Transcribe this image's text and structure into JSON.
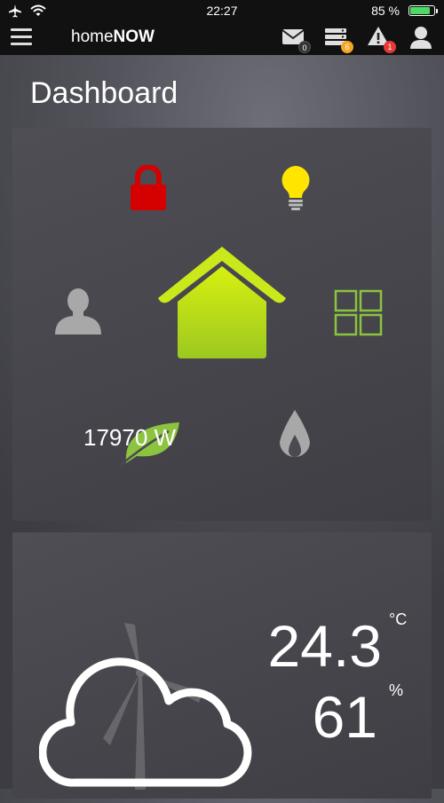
{
  "status_bar": {
    "time": "22:27",
    "battery_percent_label": "85 %",
    "battery_level": 0.85,
    "colors": {
      "battery_fill": "#4cd964"
    }
  },
  "header": {
    "brand_light": "home",
    "brand_bold": "NOW",
    "messages_count": "0",
    "server_count": "6",
    "alerts_count": "1",
    "icons": [
      "menu-icon",
      "mail-icon",
      "server-icon",
      "warning-icon",
      "user-icon"
    ],
    "colors": {
      "server_badge": "#f5a623",
      "alert_badge": "#e53935"
    }
  },
  "page": {
    "title": "Dashboard"
  },
  "home_panel": {
    "power_reading": "17970 W",
    "icons": [
      "lock-icon",
      "lightbulb-icon",
      "person-icon",
      "house-icon",
      "grid-icon",
      "leaf-icon",
      "flame-icon"
    ],
    "colors": {
      "lock": "#d50000",
      "light": "#ffe600",
      "house": "#c6e31a",
      "leaf": "#8cc33f",
      "neutral": "#a8a8a8"
    }
  },
  "weather_panel": {
    "temperature": "24.3",
    "temperature_unit": "°C",
    "humidity": "61",
    "humidity_unit": "%",
    "icons": [
      "cloud-icon",
      "wind-turbine-icon"
    ]
  }
}
